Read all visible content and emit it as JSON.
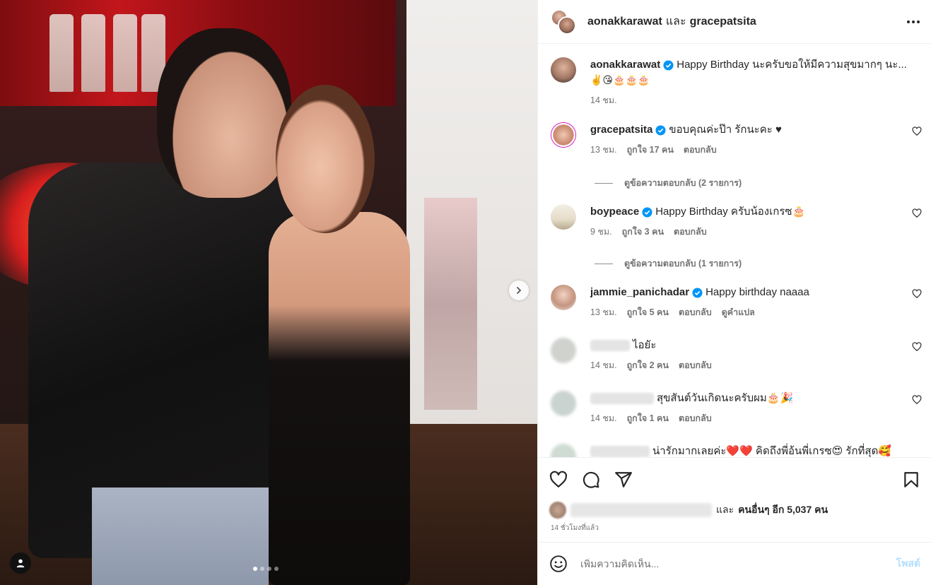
{
  "post": {
    "author1": "aonakkarawat",
    "joiner": "และ",
    "author2": "gracepatsita",
    "carousel_count": 4,
    "carousel_active": 1
  },
  "caption": {
    "username": "aonakkarawat",
    "text": "Happy Birthday นะครับขอให้มีความสุขมากๆ นะ...",
    "emoji_line": "✌️😘🎂🎂🎂",
    "time": "14 ชม."
  },
  "comments": [
    {
      "username": "gracepatsita",
      "verified": true,
      "text": "ขอบคุณค่ะป๊า รักนะคะ ♥",
      "time": "13 ชม.",
      "likes": "ถูกใจ 17 คน",
      "reply": "ตอบกลับ",
      "view_replies": "ดูข้อความตอบกลับ (2 รายการ)"
    },
    {
      "username": "boypeace",
      "verified": true,
      "text": "Happy Birthday ครับน้องเกรซ🎂",
      "time": "9 ชม.",
      "likes": "ถูกใจ 3 คน",
      "reply": "ตอบกลับ",
      "view_replies": "ดูข้อความตอบกลับ (1 รายการ)"
    },
    {
      "username": "jammie_panichadar",
      "verified": true,
      "text": "Happy birthday naaaa",
      "time": "13 ชม.",
      "likes": "ถูกใจ 5 คน",
      "reply": "ตอบกลับ",
      "translate": "ดูคำแปล"
    },
    {
      "text": "ไอยัะ",
      "time": "14 ชม.",
      "likes": "ถูกใจ 2 คน",
      "reply": "ตอบกลับ"
    },
    {
      "text": "สุขสันต์วันเกิดนะครับผม🎂🎉",
      "time": "14 ชม.",
      "likes": "ถูกใจ 1 คน",
      "reply": "ตอบกลับ"
    },
    {
      "text": "น่ารักมากเลยค่ะ❤️❤️ คิดถึงพี่อ้นพี่เกรซ😍 รักที่สุด🥰"
    }
  ],
  "likes": {
    "prefix": "และ",
    "bold": "คนอื่นๆ อีก 5,037 คน"
  },
  "timestamp": "14 ชั่วโมงที่แล้ว",
  "composer": {
    "placeholder": "เพิ่มความคิดเห็น...",
    "post_label": "โพสต์"
  },
  "colors": {
    "verified": "#0095f6",
    "post_disabled": "#b2dffc",
    "meta": "#737373"
  }
}
